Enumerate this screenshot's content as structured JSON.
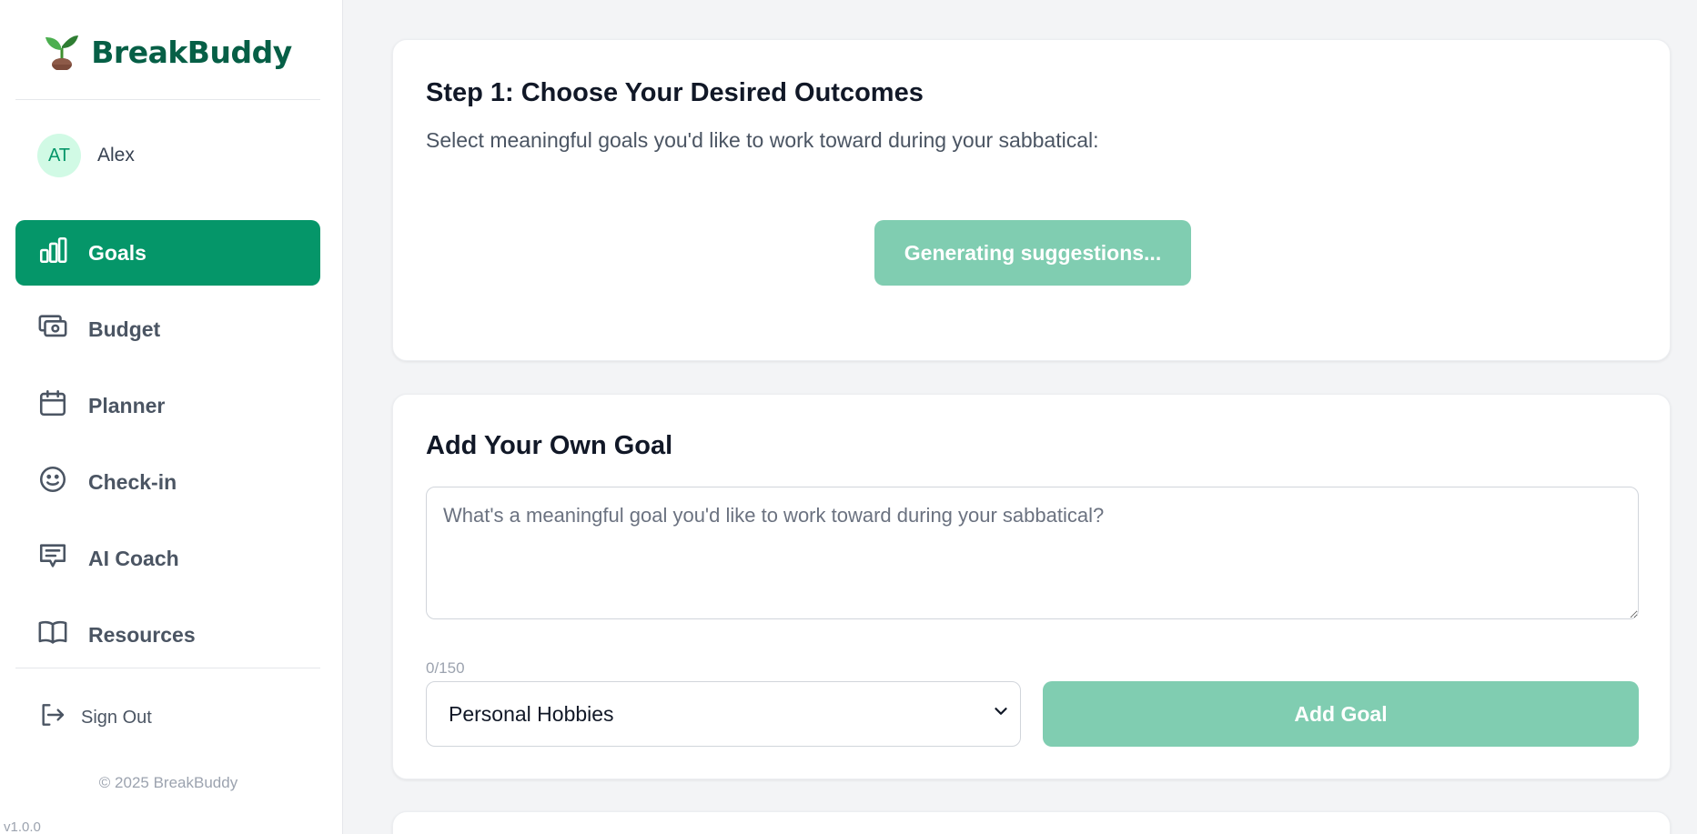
{
  "brand": {
    "name": "BreakBuddy",
    "logo_icon": "seedling-icon"
  },
  "user": {
    "initials": "AT",
    "name": "Alex"
  },
  "nav": {
    "items": [
      {
        "label": "Goals",
        "icon": "bar-chart-icon",
        "active": true
      },
      {
        "label": "Budget",
        "icon": "money-icon",
        "active": false
      },
      {
        "label": "Planner",
        "icon": "calendar-icon",
        "active": false
      },
      {
        "label": "Check-in",
        "icon": "smile-icon",
        "active": false
      },
      {
        "label": "AI Coach",
        "icon": "chat-icon",
        "active": false
      },
      {
        "label": "Resources",
        "icon": "book-icon",
        "active": false
      }
    ],
    "sign_out": "Sign Out"
  },
  "footer": {
    "copyright": "© 2025 BreakBuddy",
    "version": "v1.0.0"
  },
  "step1": {
    "title": "Step 1: Choose Your Desired Outcomes",
    "subtitle": "Select meaningful goals you'd like to work toward during your sabbatical:",
    "generate_button": "Generating suggestions..."
  },
  "add_goal": {
    "title": "Add Your Own Goal",
    "placeholder": "What's a meaningful goal you'd like to work toward during your sabbatical?",
    "char_count": "0/150",
    "category_selected": "Personal Hobbies",
    "add_button": "Add Goal"
  },
  "colors": {
    "accent": "#059669",
    "accent_disabled": "#80cdb1",
    "brand_text": "#065f46",
    "avatar_bg": "#d1fae5"
  }
}
